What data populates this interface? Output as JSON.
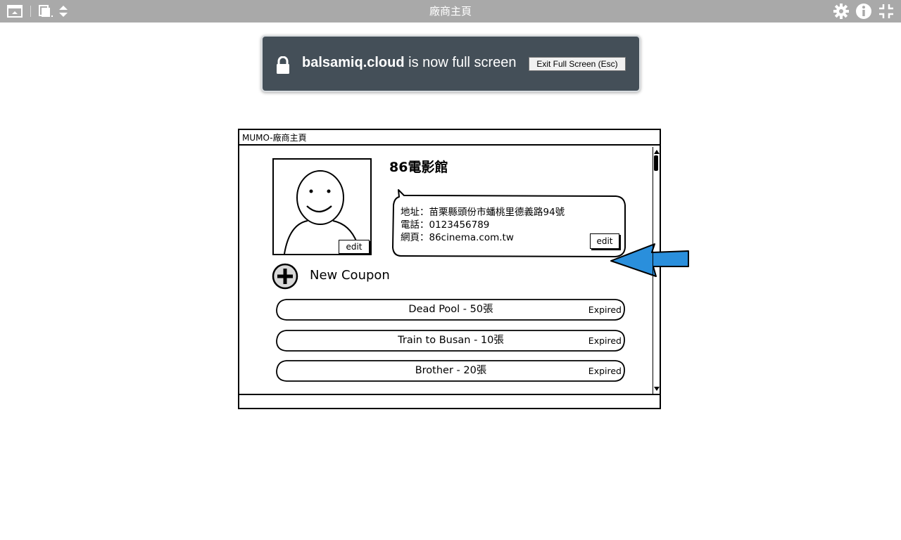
{
  "toolbar": {
    "title": "廠商主頁",
    "icons": [
      "present-icon",
      "copy-icon",
      "sort-icon",
      "gear-icon",
      "info-icon",
      "exit-fullscreen-icon"
    ]
  },
  "fullscreen_banner": {
    "domain": "balsamiq.cloud",
    "message": " is now full screen",
    "exit_button": "Exit Full Screen (Esc)"
  },
  "mockup": {
    "window_title": "MUMO-廠商主頁",
    "shop_name": "86電影館",
    "avatar_edit": "edit",
    "info": {
      "address": "地址：苗栗縣頭份市蟠桃里德義路94號",
      "phone": "電話：0123456789",
      "website": "網頁：86cinema.com.tw"
    },
    "info_edit": "edit",
    "new_coupon": "New Coupon",
    "coupons": [
      {
        "label": "Dead Pool - 50張",
        "status": "Expired"
      },
      {
        "label": "Train to Busan - 10張",
        "status": "Expired"
      },
      {
        "label": "Brother - 20張",
        "status": "Expired"
      }
    ]
  },
  "colors": {
    "toolbar": "#a9a9a9",
    "banner": "#444f58",
    "arrow": "#2a8fdc"
  }
}
